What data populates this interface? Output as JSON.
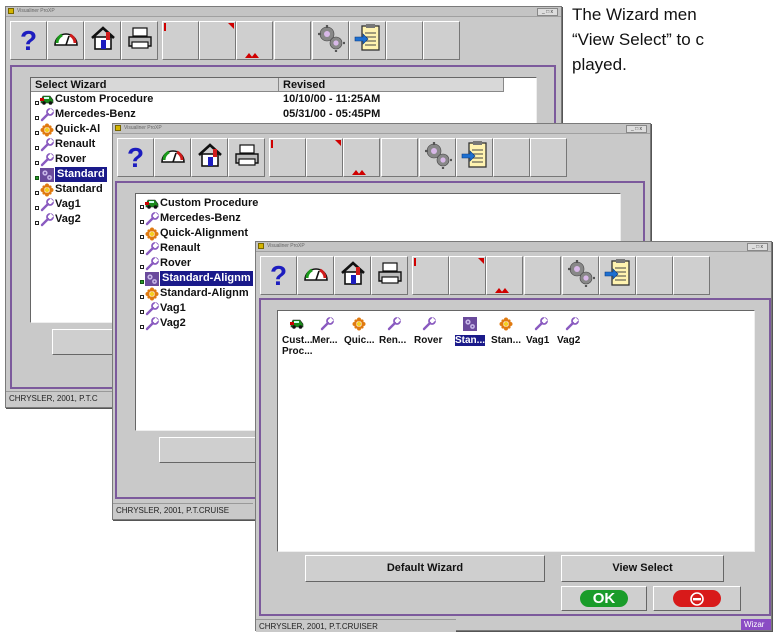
{
  "caption": {
    "line1": "The Wizard men",
    "line2": "“View Select” to c",
    "line3": "played."
  },
  "window_title": "Visualiner ProXP",
  "title_controls": "_ □ x",
  "toolbar_icons": [
    "help-icon",
    "gauge-icon",
    "home-icon",
    "printer-icon",
    "blank",
    "blank",
    "blank",
    "blank",
    "gears-icon",
    "clipboard-arrow-icon",
    "blank",
    "blank"
  ],
  "back_window": {
    "columns": [
      "Select Wizard",
      "Revised"
    ],
    "rows": [
      {
        "name": "Custom Procedure",
        "revised": "10/10/00 - 11:25AM",
        "icon": "car-icon",
        "selected": false
      },
      {
        "name": "Mercedes-Benz",
        "revised": "05/31/00 - 05:45PM",
        "icon": "wrench-icon",
        "selected": false
      },
      {
        "name": "Quick-Al",
        "revised": "",
        "icon": "gear-flower-icon",
        "selected": false
      },
      {
        "name": "Renault",
        "revised": "",
        "icon": "wrench-icon",
        "selected": false
      },
      {
        "name": "Rover",
        "revised": "",
        "icon": "wrench-icon",
        "selected": false
      },
      {
        "name": "Standard",
        "revised": "",
        "icon": "gears-icon",
        "selected": true
      },
      {
        "name": "Standard",
        "revised": "",
        "icon": "gear-flower-icon",
        "selected": false
      },
      {
        "name": "Vag1",
        "revised": "",
        "icon": "wrench-icon",
        "selected": false
      },
      {
        "name": "Vag2",
        "revised": "",
        "icon": "wrench-icon",
        "selected": false
      }
    ],
    "status": "CHRYSLER, 2001, P.T.C"
  },
  "middle_window": {
    "rows": [
      {
        "name": "Custom Procedure",
        "icon": "car-icon",
        "selected": false
      },
      {
        "name": "Mercedes-Benz",
        "icon": "wrench-icon",
        "selected": false
      },
      {
        "name": "Quick-Alignment",
        "icon": "gear-flower-icon",
        "selected": false
      },
      {
        "name": "Renault",
        "icon": "wrench-icon",
        "selected": false
      },
      {
        "name": "Rover",
        "icon": "wrench-icon",
        "selected": false
      },
      {
        "name": "Standard-Alignm",
        "icon": "gears-icon",
        "selected": true
      },
      {
        "name": "Standard-Alignm",
        "icon": "gear-flower-icon",
        "selected": false
      },
      {
        "name": "Vag1",
        "icon": "wrench-icon",
        "selected": false
      },
      {
        "name": "Vag2",
        "icon": "wrench-icon",
        "selected": false
      }
    ],
    "default_button": "De",
    "status": "CHRYSLER, 2001, P.T.CRUISE"
  },
  "front_window": {
    "items": [
      {
        "label": "Cust...",
        "label2": "Proc...",
        "icon": "car-icon",
        "selected": false
      },
      {
        "label": "Mer...",
        "label2": "",
        "icon": "wrench-icon",
        "selected": false
      },
      {
        "label": "Quic...",
        "label2": "",
        "icon": "gear-flower-icon",
        "selected": false
      },
      {
        "label": "Ren...",
        "label2": "",
        "icon": "wrench-icon",
        "selected": false
      },
      {
        "label": "Rover",
        "label2": "",
        "icon": "wrench-icon",
        "selected": false
      },
      {
        "label": "Stan...",
        "label2": "",
        "icon": "gears-icon",
        "selected": true
      },
      {
        "label": "Stan...",
        "label2": "",
        "icon": "gear-flower-icon",
        "selected": false
      },
      {
        "label": "Vag1",
        "label2": "",
        "icon": "wrench-icon",
        "selected": false
      },
      {
        "label": "Vag2",
        "label2": "",
        "icon": "wrench-icon",
        "selected": false
      }
    ],
    "default_wizard_button": "Default Wizard",
    "view_select_button": "View Select",
    "ok_button": "OK",
    "cancel_icon": "no-entry-icon",
    "status": "CHRYSLER, 2001, P.T.CRUISER",
    "status_right": "Wizar"
  },
  "colors": {
    "selection": "#1a1a8a",
    "panel_border": "#7c5a9c",
    "ok_green": "#1a9c2a",
    "cancel_red": "#d81a1a",
    "help_blue": "#1d1dbf"
  }
}
